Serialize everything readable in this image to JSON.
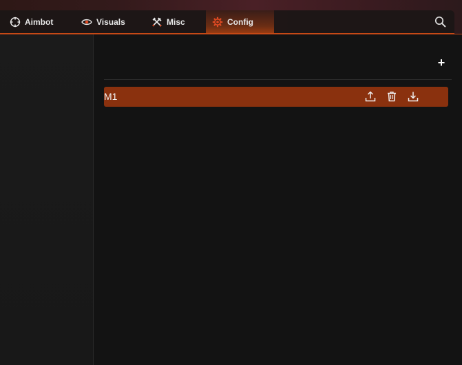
{
  "nav": {
    "tabs": [
      {
        "label": "Aimbot",
        "icon": "crosshair-icon"
      },
      {
        "label": "Visuals",
        "icon": "eye-icon"
      },
      {
        "label": "Misc",
        "icon": "tools-icon"
      },
      {
        "label": "Config",
        "icon": "gear-icon",
        "active": true
      }
    ],
    "search_icon": "search-icon"
  },
  "colors": {
    "accent": "#c84a14",
    "accent_icon": "#e04a22",
    "row_bg": "#8a310e",
    "background": "#131313"
  },
  "config": {
    "add_label": "+",
    "items": [
      {
        "name": "M1",
        "actions": [
          "upload-icon",
          "trash-icon",
          "download-icon"
        ]
      }
    ]
  }
}
